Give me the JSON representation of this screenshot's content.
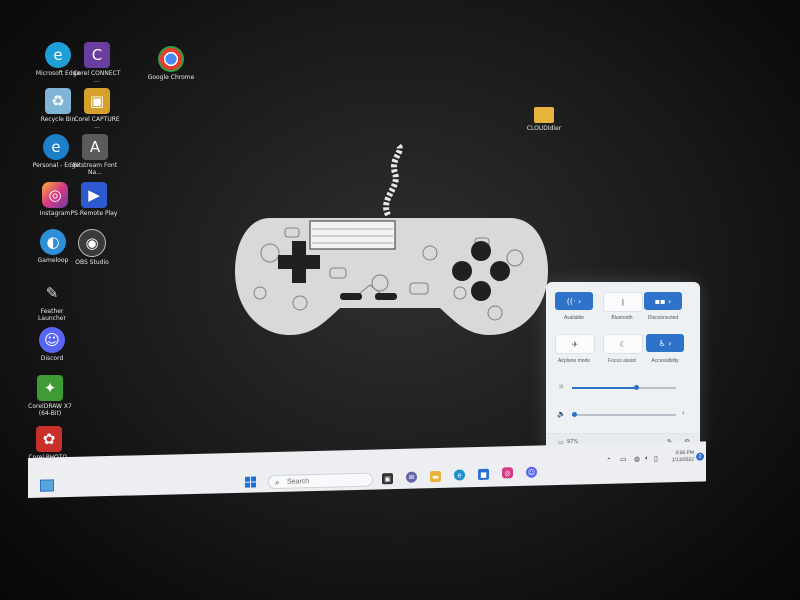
{
  "desktop": {
    "icons": [
      {
        "label": "Microsoft Edge",
        "glyph": "e",
        "color": "#1f9fd8"
      },
      {
        "label": "Corel CONNECT ...",
        "glyph": "C",
        "color": "#6a3ea1"
      },
      {
        "label": "Google Chrome",
        "glyph": "●",
        "color": "#e0402f"
      },
      {
        "label": "Recycle Bin",
        "glyph": "♻",
        "color": "#7fb5d6"
      },
      {
        "label": "Corel CAPTURE ...",
        "glyph": "▣",
        "color": "#d6a12a"
      },
      {
        "label": "Personal - Edge",
        "glyph": "e",
        "color": "#1b7fc9"
      },
      {
        "label": "Bitstream Font Na...",
        "glyph": "A",
        "color": "#5a5a5a"
      },
      {
        "label": "Instagram",
        "glyph": "◎",
        "color": "#d63a84"
      },
      {
        "label": "PS Remote Play",
        "glyph": "▶",
        "color": "#2e5ad0"
      },
      {
        "label": "Gameloop",
        "glyph": "◐",
        "color": "#2d8fd8"
      },
      {
        "label": "OBS Studio",
        "glyph": "◉",
        "color": "#3a3a3a"
      },
      {
        "label": "Feather Launcher",
        "glyph": "✎",
        "color": "#dcdcdc"
      },
      {
        "label": "Discord",
        "glyph": "☺",
        "color": "#5865f2"
      },
      {
        "label": "CorelDRAW X7 (64-Bit)",
        "glyph": "✦",
        "color": "#3f9b34"
      },
      {
        "label": "Corel PHOTO-PAI...",
        "glyph": "✿",
        "color": "#c9302c"
      },
      {
        "label": "CLOUDIdler",
        "glyph": "▬",
        "color": "#e7b53c"
      }
    ]
  },
  "quick_settings": {
    "tiles": [
      {
        "label": "Available",
        "icon": "wifi-icon",
        "glyph": "((·",
        "state": "on"
      },
      {
        "label": "Bluetooth",
        "icon": "bluetooth-icon",
        "glyph": "ᛒ",
        "state": "off"
      },
      {
        "label": "Disconnected",
        "icon": "vpn-icon",
        "glyph": "▪▪",
        "state": "on"
      },
      {
        "label": "Airplane mode",
        "icon": "airplane-icon",
        "glyph": "✈",
        "state": "off"
      },
      {
        "label": "Focus assist",
        "icon": "moon-icon",
        "glyph": "☾",
        "state": "off"
      },
      {
        "label": "Accessibility",
        "icon": "accessibility-icon",
        "glyph": "♿",
        "state": "on"
      }
    ],
    "brightness_level": 0.62,
    "volume_level": 0.02,
    "battery_text": "97%",
    "brightness_icon": "☼",
    "volume_icon": "🔈",
    "accent_color": "#2f72c9"
  },
  "taskbar": {
    "search_placeholder": "Search",
    "time": "3:56 PM",
    "date": "1/13/2022",
    "notification_count": "2",
    "apps": [
      {
        "icon": "task-view-icon",
        "glyph": "▣",
        "color": "#333333"
      },
      {
        "icon": "teams-chat-icon",
        "glyph": "✉",
        "color": "#6264a7"
      },
      {
        "icon": "file-explorer-icon",
        "glyph": "▬",
        "color": "#e7b53c"
      },
      {
        "icon": "edge-icon",
        "glyph": "e",
        "color": "#1b8fd0"
      },
      {
        "icon": "store-icon",
        "glyph": "■",
        "color": "#2b6fd6"
      },
      {
        "icon": "instagram-icon",
        "glyph": "◎",
        "color": "#d63a84"
      },
      {
        "icon": "discord-icon",
        "glyph": "☺",
        "color": "#5865f2"
      }
    ]
  }
}
